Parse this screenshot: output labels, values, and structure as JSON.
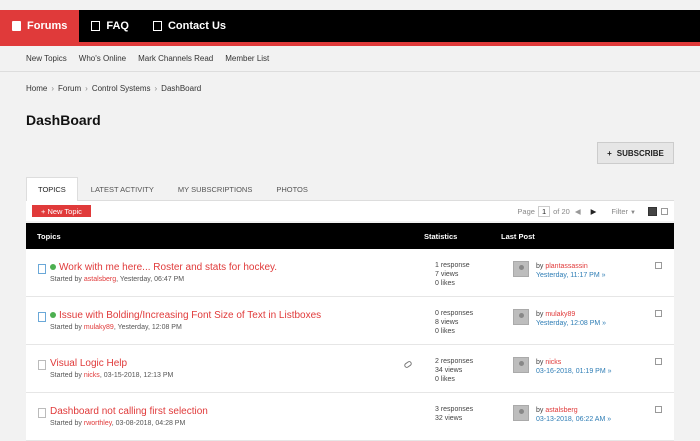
{
  "top_nav": [
    {
      "label": "Forums",
      "icon": "forum-icon",
      "active": true
    },
    {
      "label": "FAQ",
      "icon": "document-icon",
      "active": false
    },
    {
      "label": "Contact Us",
      "icon": "document-icon",
      "active": false
    }
  ],
  "sub_nav": [
    "New Topics",
    "Who's Online",
    "Mark Channels Read",
    "Member List"
  ],
  "breadcrumb": [
    "Home",
    "Forum",
    "Control Systems",
    "DashBoard"
  ],
  "breadcrumb_sep": "›",
  "page_title": "DashBoard",
  "subscribe_label": "SUBSCRIBE",
  "tabs": [
    "TOPICS",
    "LATEST ACTIVITY",
    "MY SUBSCRIPTIONS",
    "PHOTOS"
  ],
  "new_topic_label": "+ New Topic",
  "pager": {
    "page_label": "Page",
    "page": "1",
    "of_label": "of 20",
    "filter_label": "Filter"
  },
  "table_headers": {
    "topics": "Topics",
    "statistics": "Statistics",
    "last_post": "Last Post"
  },
  "topics": [
    {
      "title": "Work with me here... Roster and stats for hockey.",
      "started_prefix": "Started by ",
      "author": "astalsberg",
      "started_date": ", Yesterday, 06:47 PM",
      "responses": "1 response",
      "views": "7 views",
      "likes": "0 likes",
      "by_prefix": "by ",
      "last_user": "plantassassin",
      "last_time": "Yesterday, 11:17 PM",
      "goto": "»",
      "new": true,
      "attachment": false
    },
    {
      "title": "Issue with Bolding/Increasing Font Size of Text in Listboxes",
      "started_prefix": "Started by ",
      "author": "mulaky89",
      "started_date": ", Yesterday, 12:08 PM",
      "responses": "0 responses",
      "views": "8 views",
      "likes": "0 likes",
      "by_prefix": "by ",
      "last_user": "mulaky89",
      "last_time": "Yesterday, 12:08 PM",
      "goto": "»",
      "new": true,
      "attachment": false
    },
    {
      "title": "Visual Logic Help",
      "started_prefix": "Started by ",
      "author": "nicks",
      "started_date": ", 03-15-2018, 12:13 PM",
      "responses": "2 responses",
      "views": "34 views",
      "likes": "0 likes",
      "by_prefix": "by ",
      "last_user": "nicks",
      "last_time": "03-16-2018, 01:19 PM",
      "goto": "»",
      "new": false,
      "attachment": true
    },
    {
      "title": "Dashboard not calling first selection",
      "started_prefix": "Started by ",
      "author": "rworthley",
      "started_date": ", 03-08-2018, 04:28 PM",
      "responses": "3 responses",
      "views": "32 views",
      "likes": "",
      "by_prefix": "by ",
      "last_user": "astalsberg",
      "last_time": "03-13-2018, 06:22 AM",
      "goto": "»",
      "new": false,
      "attachment": false
    }
  ],
  "colors": {
    "accent": "#e03a3a",
    "link_blue": "#2e7db5",
    "header_bg": "#000000"
  }
}
